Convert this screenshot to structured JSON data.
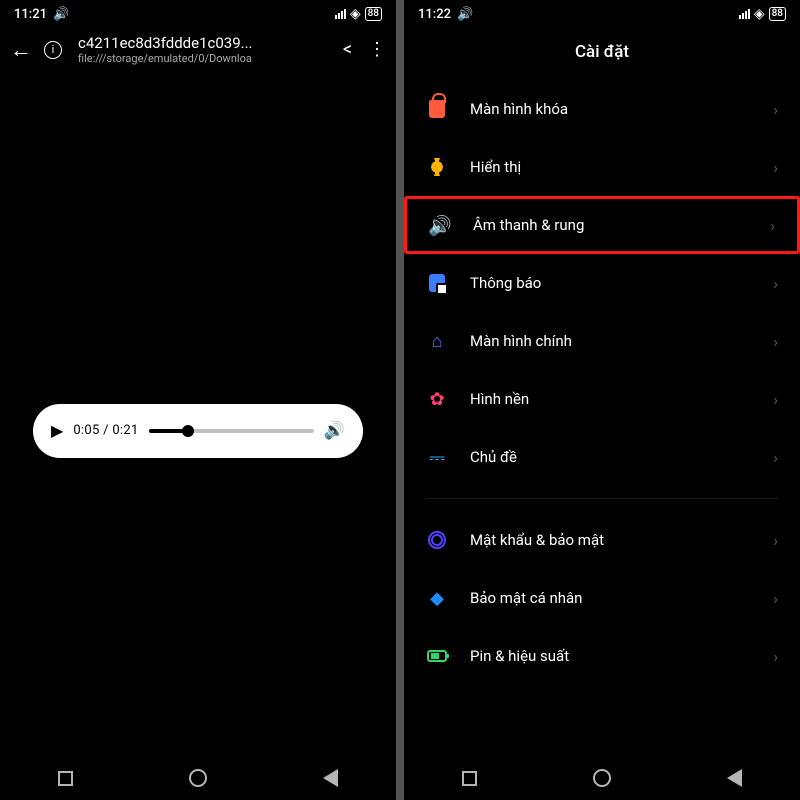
{
  "left": {
    "status": {
      "time": "11:21",
      "battery": "88"
    },
    "header": {
      "title": "c4211ec8d3fddde1c039...",
      "url": "file:///storage/emulated/0/Downloa"
    },
    "player": {
      "current": "0:05",
      "duration": "0:21",
      "progress_pct": 24
    }
  },
  "right": {
    "status": {
      "time": "11:22",
      "battery": "88"
    },
    "title": "Cài đặt",
    "items": [
      {
        "icon": "lock",
        "label": "Màn hình khóa",
        "highlight": false
      },
      {
        "icon": "sun",
        "label": "Hiển thị",
        "highlight": false
      },
      {
        "icon": "sound",
        "label": "Âm thanh & rung",
        "highlight": true
      },
      {
        "icon": "notif",
        "label": "Thông báo",
        "highlight": false
      },
      {
        "icon": "home",
        "label": "Màn hình chính",
        "highlight": false
      },
      {
        "icon": "wall",
        "label": "Hình nền",
        "highlight": false
      },
      {
        "icon": "theme",
        "label": "Chủ đề",
        "highlight": false
      }
    ],
    "items2": [
      {
        "icon": "security",
        "label": "Mật khẩu & bảo mật",
        "highlight": false
      },
      {
        "icon": "privacy",
        "label": "Bảo mật cá nhân",
        "highlight": false
      },
      {
        "icon": "battery",
        "label": "Pin & hiệu suất",
        "highlight": false
      }
    ]
  },
  "icon_names": {
    "lock": "lock-icon",
    "sun": "sun-icon",
    "sound": "sound-icon",
    "notif": "notification-icon",
    "home": "home-icon",
    "wall": "wallpaper-icon",
    "theme": "theme-icon",
    "security": "fingerprint-icon",
    "privacy": "shield-icon",
    "battery": "battery-icon"
  }
}
